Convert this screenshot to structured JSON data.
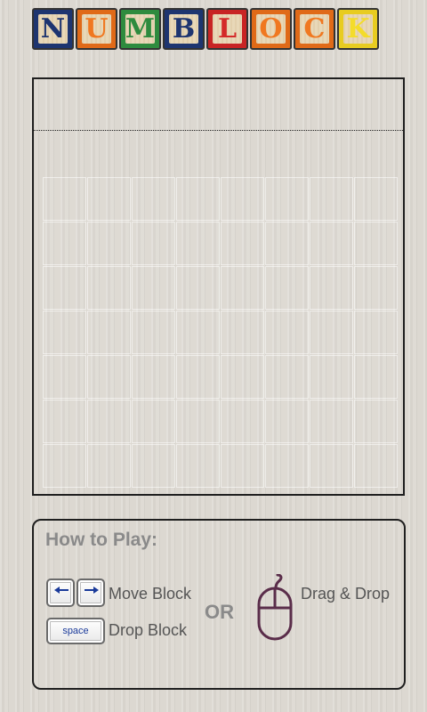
{
  "logo": {
    "letters": [
      {
        "char": "N",
        "letter_color": "#1e3570",
        "border_color": "#1e3570"
      },
      {
        "char": "U",
        "letter_color": "#f07820",
        "border_color": "#e06a18"
      },
      {
        "char": "M",
        "letter_color": "#2e8b3e",
        "border_color": "#2e8b3e"
      },
      {
        "char": "B",
        "letter_color": "#1e3570",
        "border_color": "#1e3570"
      },
      {
        "char": "L",
        "letter_color": "#d42a2a",
        "border_color": "#c82424"
      },
      {
        "char": "O",
        "letter_color": "#f07820",
        "border_color": "#e06a18"
      },
      {
        "char": "C",
        "letter_color": "#f07820",
        "border_color": "#e06a18"
      },
      {
        "char": "K",
        "letter_color": "#f4dc2a",
        "border_color": "#e8cc20"
      }
    ]
  },
  "board": {
    "columns": 8,
    "rows": 7
  },
  "how_to_play": {
    "title": "How to Play:",
    "move_label": "Move Block",
    "drop_label": "Drop Block",
    "space_key_label": "space",
    "or_label": "OR",
    "drag_label": "Drag & Drop",
    "key_arrow_color": "#1a3a9a",
    "mouse_color": "#5a2d4a"
  }
}
